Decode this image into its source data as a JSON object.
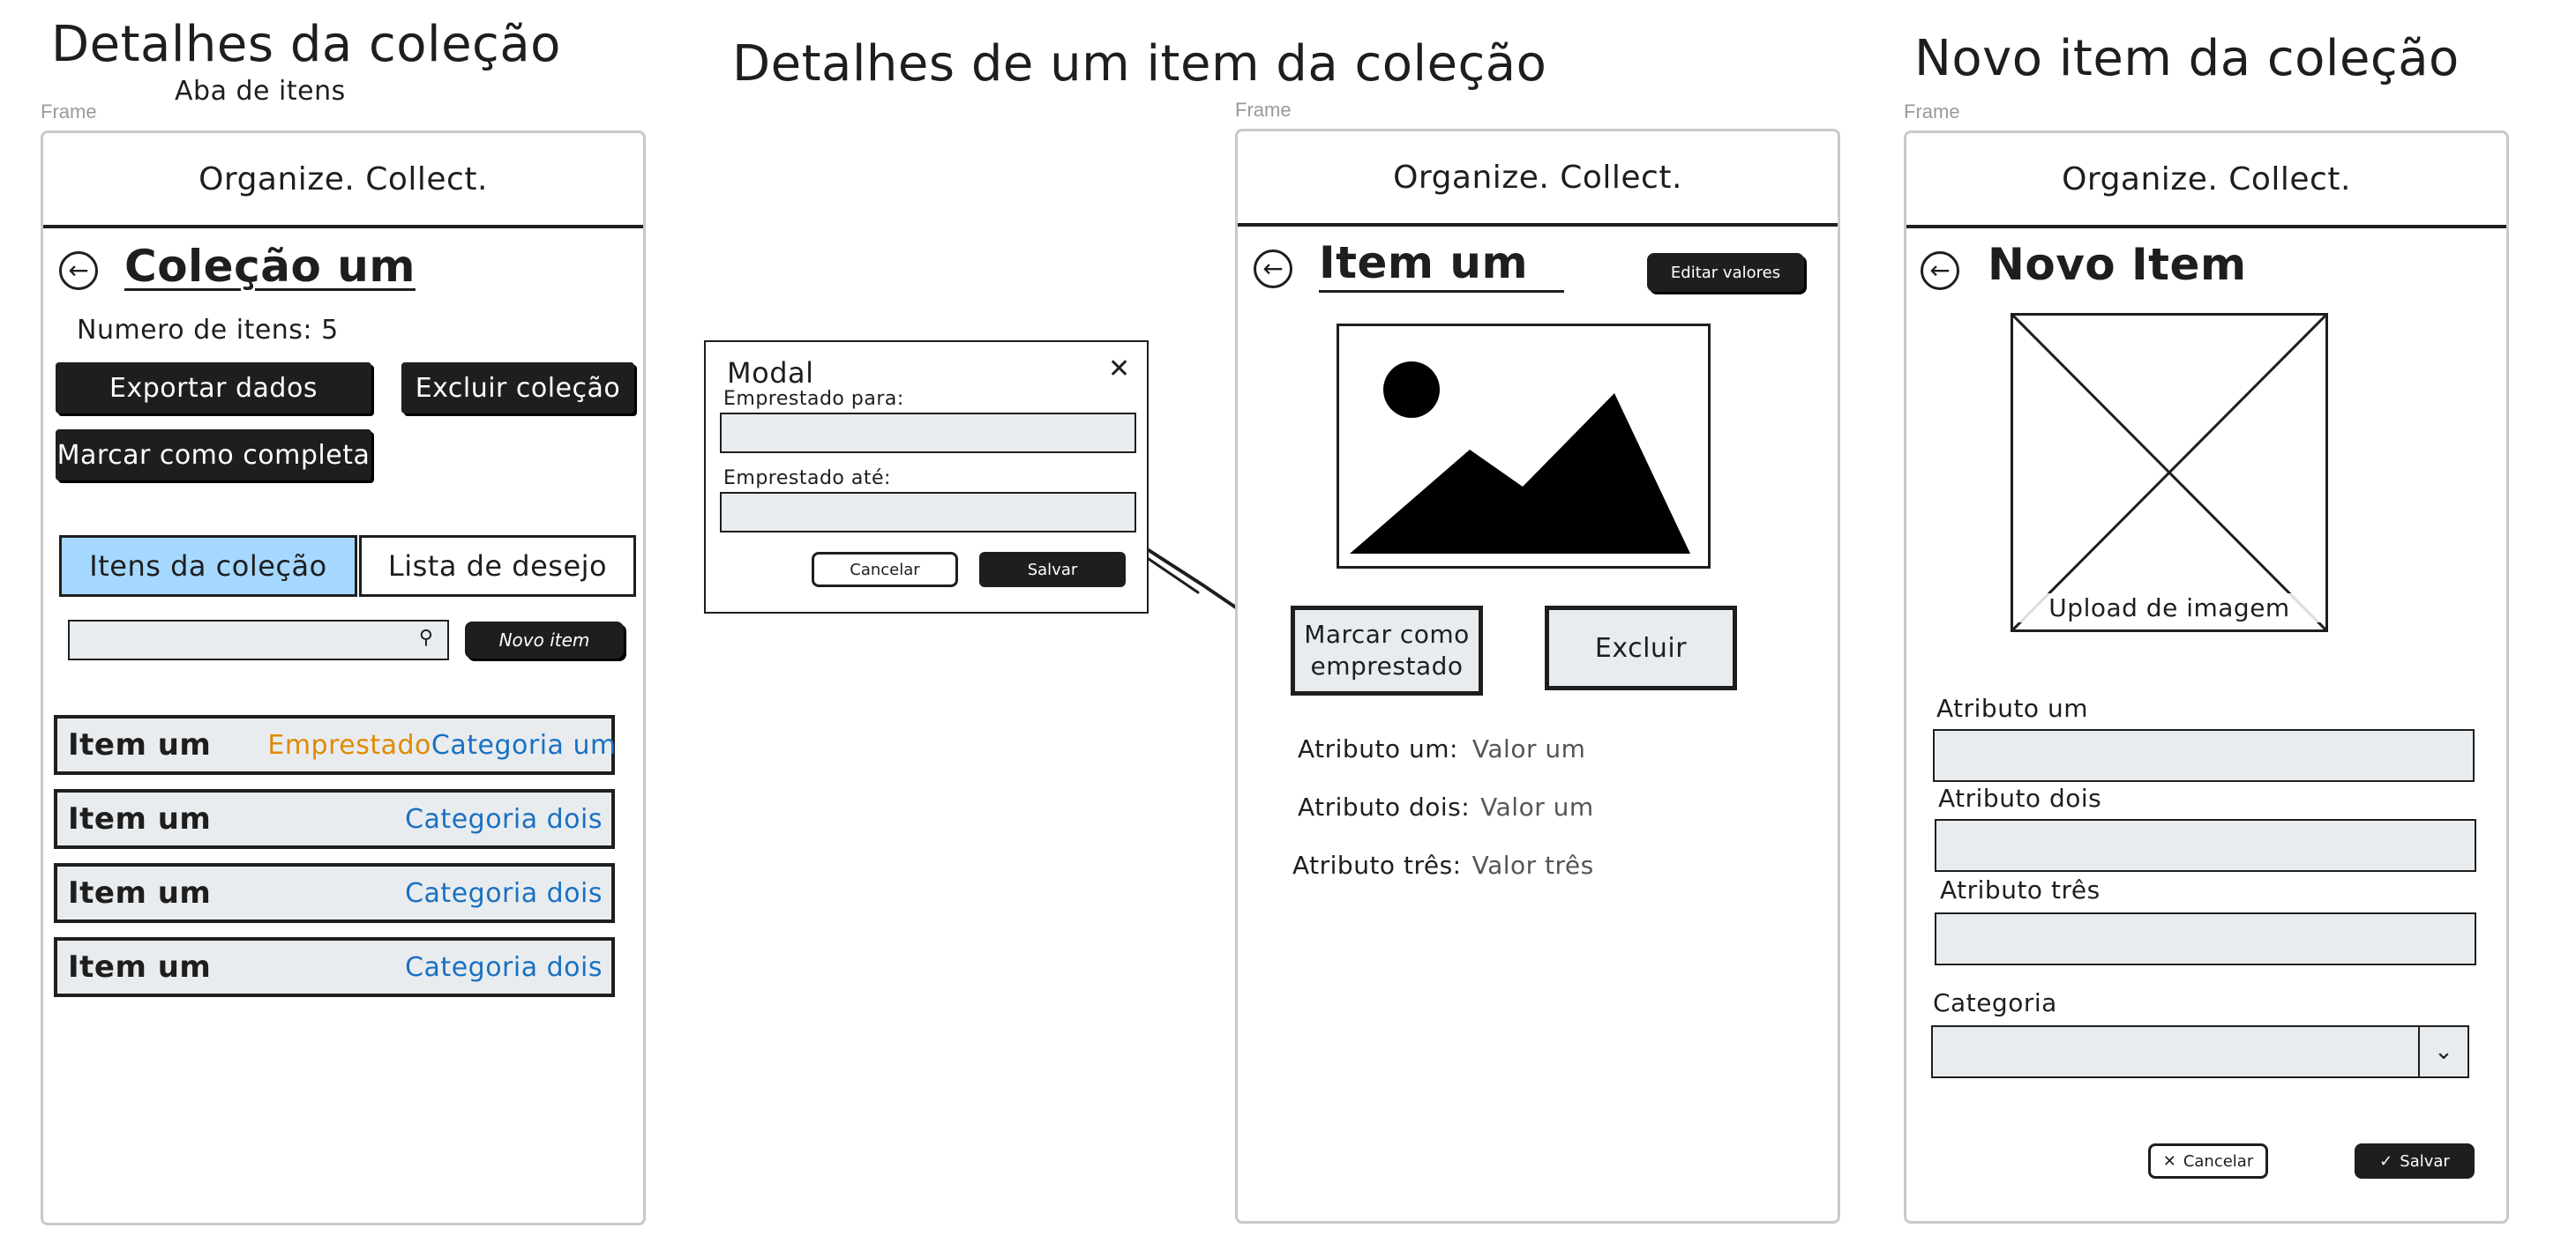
{
  "boards": {
    "collection_details": {
      "title": "Detalhes da coleção",
      "subtitle": "Aba de itens"
    },
    "item_details": {
      "title": "Detalhes de um item da coleção"
    },
    "new_item": {
      "title": "Novo item da coleção"
    }
  },
  "frame_label": "Frame",
  "app": {
    "brand": "Organize. Collect."
  },
  "collection": {
    "title": "Coleção um",
    "item_count": "Numero de itens: 5",
    "export_label": "Exportar dados",
    "delete_label": "Excluir coleção",
    "complete_label": "Marcar como completa",
    "tabs": [
      {
        "label": "Itens da coleção",
        "active": true
      },
      {
        "label": "Lista de desejo",
        "active": false
      }
    ],
    "search_placeholder": "",
    "new_item_label": "Novo item",
    "items": [
      {
        "name": "Item um",
        "status": "Emprestado",
        "category": "Categoria um"
      },
      {
        "name": "Item um",
        "status": "",
        "category": "Categoria dois"
      },
      {
        "name": "Item um",
        "status": "",
        "category": "Categoria dois"
      },
      {
        "name": "Item um",
        "status": "",
        "category": "Categoria dois"
      }
    ]
  },
  "modal": {
    "title": "Modal",
    "lent_to_label": "Emprestado para:",
    "lent_until_label": "Emprestado até:",
    "cancel_label": "Cancelar",
    "save_label": "Salvar"
  },
  "item": {
    "title": "Item um",
    "edit_label": "Editar valores",
    "lend_label_line1": "Marcar como",
    "lend_label_line2": "emprestado",
    "delete_label": "Excluir",
    "attributes": [
      {
        "label": "Atributo um:",
        "value": "Valor um"
      },
      {
        "label": "Atributo dois:",
        "value": "Valor um"
      },
      {
        "label": "Atributo três:",
        "value": "Valor três"
      }
    ]
  },
  "new_item": {
    "title": "Novo Item",
    "upload_label": "Upload de imagem",
    "fields": [
      {
        "label": "Atributo um"
      },
      {
        "label": "Atributo dois"
      },
      {
        "label": "Atributo três"
      }
    ],
    "category_label": "Categoria",
    "cancel_label": "Cancelar",
    "save_label": "Salvar"
  },
  "colors": {
    "tab_active": "#a5d8ff",
    "category": "#1971c2",
    "status": "#e08a00",
    "input_bg": "#e9ecef"
  }
}
